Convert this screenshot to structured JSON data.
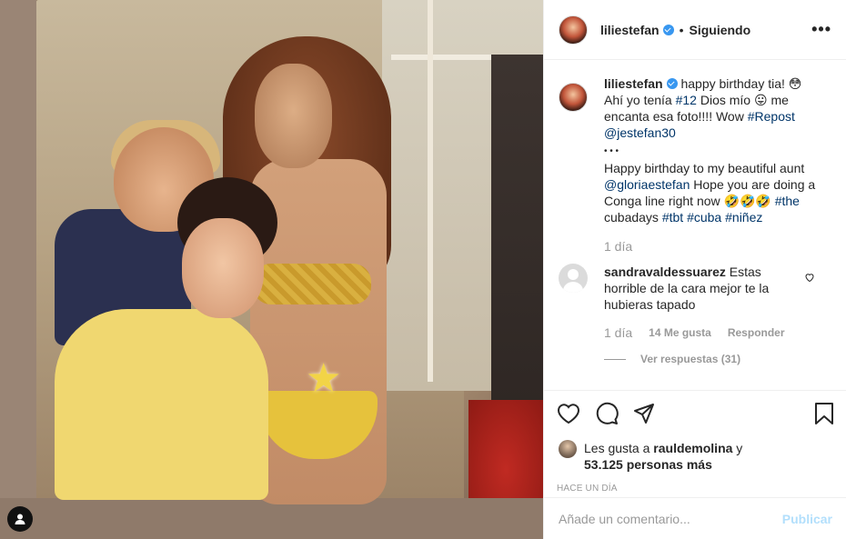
{
  "post": {
    "username": "liliestefan",
    "following_label": "Siguiendo",
    "more_label": "•••",
    "caption": {
      "greeting": "happy birthday tia! 😳",
      "line2_pre": "Ahí yo tenía ",
      "hashtag_12": "#12",
      "line2_post": " Dios mío 😛 me encanta esa foto!!!! Wow ",
      "hashtag_repost": "#Repost",
      "mention_jestefan": "@jestefan30",
      "dots": "• • •",
      "para2_pre": "Happy birthday to my beautiful aunt ",
      "mention_gloria": "@gloriaestefan",
      "para2_mid": " Hope you are doing a Conga line right now 🤣🤣🤣 ",
      "hashtag_the": "#the",
      "para2_word": "cubadays",
      "hashtag_tbt": "#tbt",
      "hashtag_cuba": "#cuba",
      "hashtag_ninez": "#niñez"
    },
    "caption_time": "1 día",
    "comment": {
      "username": "sandravaldessuarez",
      "text": "Estas horrible de la cara mejor te la hubieras tapado",
      "time": "1 día",
      "likes": "14 Me gusta",
      "reply_label": "Responder",
      "view_replies": "Ver respuestas (31)"
    },
    "likes": {
      "prefix": "Les gusta a ",
      "user": "rauldemolina",
      "mid": " y",
      "count": "53.125 personas más"
    },
    "posted_ago": "HACE UN DÍA",
    "add_comment_placeholder": "Añade un comentario...",
    "publish_label": "Publicar"
  },
  "colors": {
    "accent_link": "#003569",
    "verified": "#3897f0",
    "publish_disabled": "#b2dffc",
    "muted": "#999999"
  },
  "icons": [
    "verified-badge-icon",
    "more-options-icon",
    "heart-icon",
    "comment-icon",
    "share-icon",
    "bookmark-icon",
    "user-tag-icon",
    "star-sticker-icon"
  ]
}
